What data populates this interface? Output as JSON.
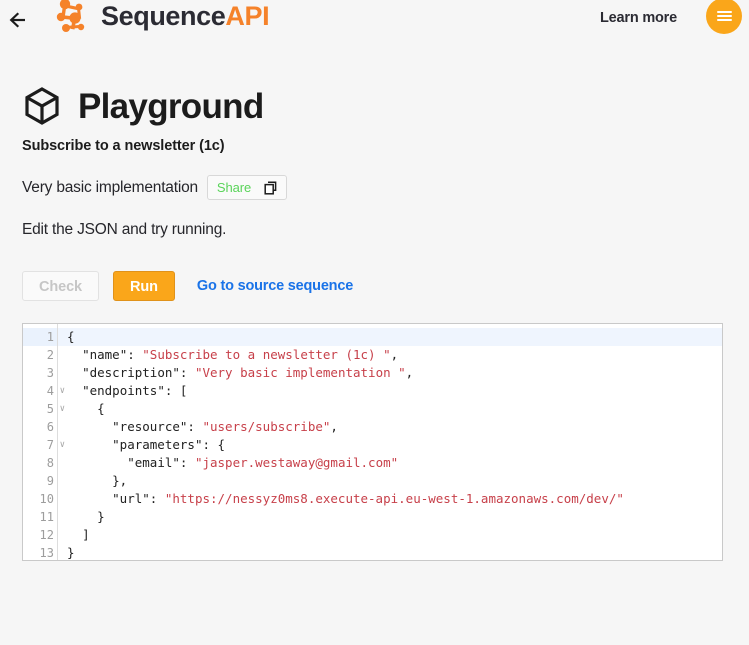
{
  "header": {
    "back_icon": "back-arrow-icon",
    "brand_primary": "Sequence",
    "brand_accent": "API",
    "logo_icon": "sequence-molecule-logo-icon",
    "learn_more_label": "Learn more",
    "menu_icon": "hamburger-menu-icon",
    "accent_color": "#f5822a",
    "menu_button_color": "#faa61a"
  },
  "page": {
    "icon": "cube-icon",
    "title": "Playground",
    "subtitle": "Subscribe to a newsletter (1c)",
    "description": "Very basic implementation",
    "share_label": "Share",
    "share_icon": "copy-icon",
    "share_color": "#5ad45a",
    "hint": "Edit the JSON and try running."
  },
  "actions": {
    "check_label": "Check",
    "run_label": "Run",
    "source_link_label": "Go to source sequence",
    "run_color": "#faa61a",
    "link_color": "#1a73e8"
  },
  "editor": {
    "active_line": 1,
    "fold_lines": [
      1,
      4,
      5,
      7
    ],
    "line_numbers": [
      "1",
      "2",
      "3",
      "4",
      "5",
      "6",
      "7",
      "8",
      "9",
      "10",
      "11",
      "12",
      "13"
    ],
    "lines": [
      {
        "n": 1,
        "indent": 0,
        "tokens": [
          {
            "t": "{",
            "c": "key"
          }
        ]
      },
      {
        "n": 2,
        "indent": 2,
        "tokens": [
          {
            "t": "\"name\": ",
            "c": "key"
          },
          {
            "t": "\"Subscribe to a newsletter (1c) \"",
            "c": "str"
          },
          {
            "t": ",",
            "c": "key"
          }
        ]
      },
      {
        "n": 3,
        "indent": 2,
        "tokens": [
          {
            "t": "\"description\": ",
            "c": "key"
          },
          {
            "t": "\"Very basic implementation \"",
            "c": "str"
          },
          {
            "t": ",",
            "c": "key"
          }
        ]
      },
      {
        "n": 4,
        "indent": 2,
        "tokens": [
          {
            "t": "\"endpoints\": [",
            "c": "key"
          }
        ]
      },
      {
        "n": 5,
        "indent": 4,
        "tokens": [
          {
            "t": "{",
            "c": "key"
          }
        ]
      },
      {
        "n": 6,
        "indent": 6,
        "tokens": [
          {
            "t": "\"resource\": ",
            "c": "key"
          },
          {
            "t": "\"users/subscribe\"",
            "c": "str"
          },
          {
            "t": ",",
            "c": "key"
          }
        ]
      },
      {
        "n": 7,
        "indent": 6,
        "tokens": [
          {
            "t": "\"parameters\": {",
            "c": "key"
          }
        ]
      },
      {
        "n": 8,
        "indent": 8,
        "tokens": [
          {
            "t": "\"email\": ",
            "c": "key"
          },
          {
            "t": "\"jasper.westaway@gmail.com\"",
            "c": "str"
          }
        ]
      },
      {
        "n": 9,
        "indent": 6,
        "tokens": [
          {
            "t": "},",
            "c": "key"
          }
        ]
      },
      {
        "n": 10,
        "indent": 6,
        "tokens": [
          {
            "t": "\"url\": ",
            "c": "key"
          },
          {
            "t": "\"https://nessyz0ms8.execute-api.eu-west-1.amazonaws.com/dev/\"",
            "c": "str"
          }
        ]
      },
      {
        "n": 11,
        "indent": 4,
        "tokens": [
          {
            "t": "}",
            "c": "key"
          }
        ]
      },
      {
        "n": 12,
        "indent": 2,
        "tokens": [
          {
            "t": "]",
            "c": "key"
          }
        ]
      },
      {
        "n": 13,
        "indent": 0,
        "tokens": [
          {
            "t": "}",
            "c": "key"
          }
        ]
      }
    ]
  }
}
